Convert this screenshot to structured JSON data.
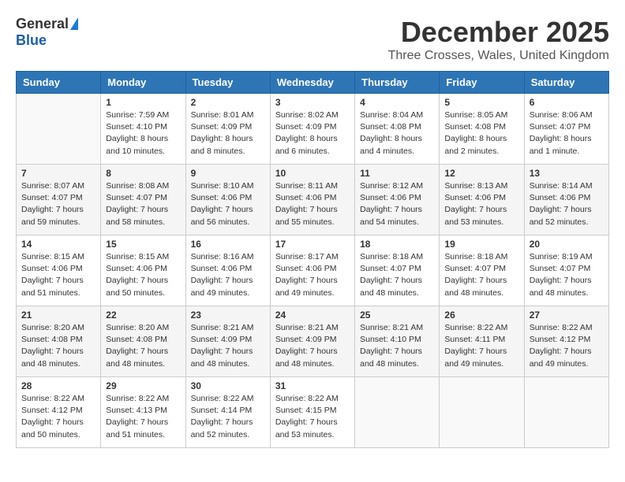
{
  "header": {
    "logo_general": "General",
    "logo_blue": "Blue",
    "month_title": "December 2025",
    "location": "Three Crosses, Wales, United Kingdom"
  },
  "calendar": {
    "days_of_week": [
      "Sunday",
      "Monday",
      "Tuesday",
      "Wednesday",
      "Thursday",
      "Friday",
      "Saturday"
    ],
    "weeks": [
      [
        {
          "day": "",
          "info": ""
        },
        {
          "day": "1",
          "info": "Sunrise: 7:59 AM\nSunset: 4:10 PM\nDaylight: 8 hours\nand 10 minutes."
        },
        {
          "day": "2",
          "info": "Sunrise: 8:01 AM\nSunset: 4:09 PM\nDaylight: 8 hours\nand 8 minutes."
        },
        {
          "day": "3",
          "info": "Sunrise: 8:02 AM\nSunset: 4:09 PM\nDaylight: 8 hours\nand 6 minutes."
        },
        {
          "day": "4",
          "info": "Sunrise: 8:04 AM\nSunset: 4:08 PM\nDaylight: 8 hours\nand 4 minutes."
        },
        {
          "day": "5",
          "info": "Sunrise: 8:05 AM\nSunset: 4:08 PM\nDaylight: 8 hours\nand 2 minutes."
        },
        {
          "day": "6",
          "info": "Sunrise: 8:06 AM\nSunset: 4:07 PM\nDaylight: 8 hours\nand 1 minute."
        }
      ],
      [
        {
          "day": "7",
          "info": "Sunrise: 8:07 AM\nSunset: 4:07 PM\nDaylight: 7 hours\nand 59 minutes."
        },
        {
          "day": "8",
          "info": "Sunrise: 8:08 AM\nSunset: 4:07 PM\nDaylight: 7 hours\nand 58 minutes."
        },
        {
          "day": "9",
          "info": "Sunrise: 8:10 AM\nSunset: 4:06 PM\nDaylight: 7 hours\nand 56 minutes."
        },
        {
          "day": "10",
          "info": "Sunrise: 8:11 AM\nSunset: 4:06 PM\nDaylight: 7 hours\nand 55 minutes."
        },
        {
          "day": "11",
          "info": "Sunrise: 8:12 AM\nSunset: 4:06 PM\nDaylight: 7 hours\nand 54 minutes."
        },
        {
          "day": "12",
          "info": "Sunrise: 8:13 AM\nSunset: 4:06 PM\nDaylight: 7 hours\nand 53 minutes."
        },
        {
          "day": "13",
          "info": "Sunrise: 8:14 AM\nSunset: 4:06 PM\nDaylight: 7 hours\nand 52 minutes."
        }
      ],
      [
        {
          "day": "14",
          "info": "Sunrise: 8:15 AM\nSunset: 4:06 PM\nDaylight: 7 hours\nand 51 minutes."
        },
        {
          "day": "15",
          "info": "Sunrise: 8:15 AM\nSunset: 4:06 PM\nDaylight: 7 hours\nand 50 minutes."
        },
        {
          "day": "16",
          "info": "Sunrise: 8:16 AM\nSunset: 4:06 PM\nDaylight: 7 hours\nand 49 minutes."
        },
        {
          "day": "17",
          "info": "Sunrise: 8:17 AM\nSunset: 4:06 PM\nDaylight: 7 hours\nand 49 minutes."
        },
        {
          "day": "18",
          "info": "Sunrise: 8:18 AM\nSunset: 4:07 PM\nDaylight: 7 hours\nand 48 minutes."
        },
        {
          "day": "19",
          "info": "Sunrise: 8:18 AM\nSunset: 4:07 PM\nDaylight: 7 hours\nand 48 minutes."
        },
        {
          "day": "20",
          "info": "Sunrise: 8:19 AM\nSunset: 4:07 PM\nDaylight: 7 hours\nand 48 minutes."
        }
      ],
      [
        {
          "day": "21",
          "info": "Sunrise: 8:20 AM\nSunset: 4:08 PM\nDaylight: 7 hours\nand 48 minutes."
        },
        {
          "day": "22",
          "info": "Sunrise: 8:20 AM\nSunset: 4:08 PM\nDaylight: 7 hours\nand 48 minutes."
        },
        {
          "day": "23",
          "info": "Sunrise: 8:21 AM\nSunset: 4:09 PM\nDaylight: 7 hours\nand 48 minutes."
        },
        {
          "day": "24",
          "info": "Sunrise: 8:21 AM\nSunset: 4:09 PM\nDaylight: 7 hours\nand 48 minutes."
        },
        {
          "day": "25",
          "info": "Sunrise: 8:21 AM\nSunset: 4:10 PM\nDaylight: 7 hours\nand 48 minutes."
        },
        {
          "day": "26",
          "info": "Sunrise: 8:22 AM\nSunset: 4:11 PM\nDaylight: 7 hours\nand 49 minutes."
        },
        {
          "day": "27",
          "info": "Sunrise: 8:22 AM\nSunset: 4:12 PM\nDaylight: 7 hours\nand 49 minutes."
        }
      ],
      [
        {
          "day": "28",
          "info": "Sunrise: 8:22 AM\nSunset: 4:12 PM\nDaylight: 7 hours\nand 50 minutes."
        },
        {
          "day": "29",
          "info": "Sunrise: 8:22 AM\nSunset: 4:13 PM\nDaylight: 7 hours\nand 51 minutes."
        },
        {
          "day": "30",
          "info": "Sunrise: 8:22 AM\nSunset: 4:14 PM\nDaylight: 7 hours\nand 52 minutes."
        },
        {
          "day": "31",
          "info": "Sunrise: 8:22 AM\nSunset: 4:15 PM\nDaylight: 7 hours\nand 53 minutes."
        },
        {
          "day": "",
          "info": ""
        },
        {
          "day": "",
          "info": ""
        },
        {
          "day": "",
          "info": ""
        }
      ]
    ]
  }
}
